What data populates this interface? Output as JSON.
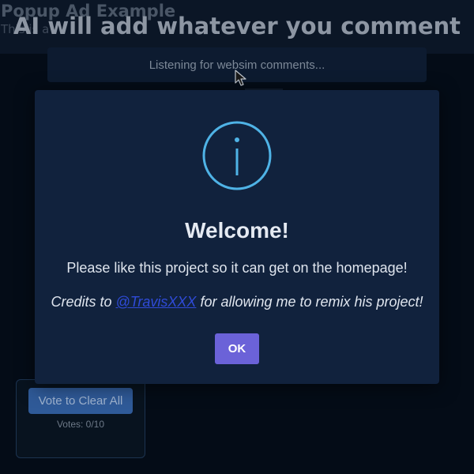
{
  "background": {
    "popup_ad_title": "Popup Ad Example",
    "popup_ad_subtitle": "This is a",
    "main_title": "AI will add whatever you comment",
    "listening_text": "Listening for websim comments...",
    "vote_panel": {
      "button_label": "Vote to Clear All",
      "votes_text": "Votes: 0/10"
    }
  },
  "modal": {
    "icon": "info-icon",
    "title": "Welcome!",
    "message": "Please like this project so it can get on the homepage!",
    "credits_prefix": "Credits to ",
    "credits_link": "@TravisXXX",
    "credits_suffix": " for allowing me to remix his project!",
    "ok_label": "OK"
  },
  "colors": {
    "modal_bg": "#11223d",
    "accent_icon": "#4fb3e6",
    "ok_button": "#6b62d8",
    "link": "#2f4bd8",
    "vote_button": "#2f5a98"
  }
}
